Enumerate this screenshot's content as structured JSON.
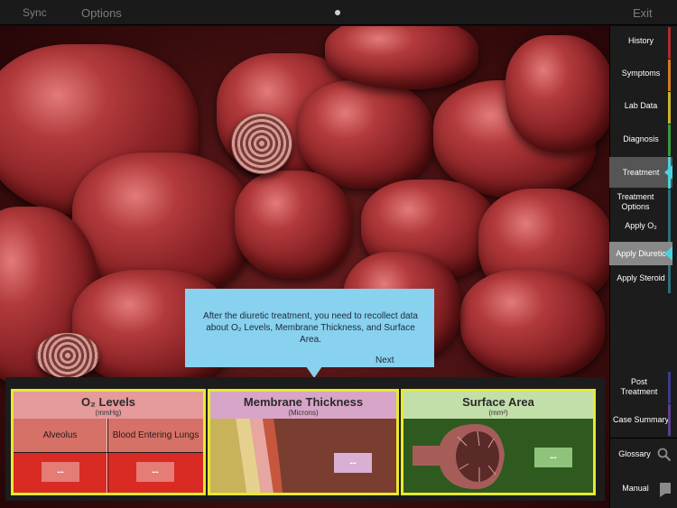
{
  "topbar": {
    "sync": "Sync",
    "options": "Options",
    "exit": "Exit"
  },
  "sidebar": {
    "items": [
      {
        "label": "History",
        "bar_color": "#b02a2a"
      },
      {
        "label": "Symptoms",
        "bar_color": "#d07a1e"
      },
      {
        "label": "Lab Data",
        "bar_color": "#c9b62a"
      },
      {
        "label": "Diagnosis",
        "bar_color": "#3b9a3b"
      },
      {
        "label": "Treatment",
        "bar_color": "#4ad4df"
      },
      {
        "label": "Treatment Options",
        "bar_color": "#2a6f7a"
      },
      {
        "label": "Apply O₂",
        "bar_color": "#2a6f7a"
      },
      {
        "label": "Apply Diuretic",
        "bar_color": "#4ad4df"
      },
      {
        "label": "Apply Steroid",
        "bar_color": "#2a6f7a"
      },
      {
        "label": "Post Treatment",
        "bar_color": "#3d3a8a"
      },
      {
        "label": "Case Summary",
        "bar_color": "#5a3f8f"
      },
      {
        "label": "Glossary",
        "icon": "search-icon"
      },
      {
        "label": "Manual",
        "icon": "chat-bubble-icon"
      }
    ]
  },
  "tooltip": {
    "text": "After the diuretic treatment, you need to recollect data about O₂ Levels, Membrane Thickness, and Surface Area.",
    "next": "Next"
  },
  "panels": {
    "o2": {
      "title": "O₂ Levels",
      "unit": "(mmHg)",
      "alveolus_label": "Alveolus",
      "blood_label": "Blood Entering Lungs",
      "alveolus_value": "--",
      "blood_value": "--"
    },
    "membrane": {
      "title": "Membrane Thickness",
      "unit": "(Microns)",
      "value": "--"
    },
    "surface": {
      "title": "Surface Area",
      "unit": "(mm²)",
      "value": "--"
    }
  }
}
